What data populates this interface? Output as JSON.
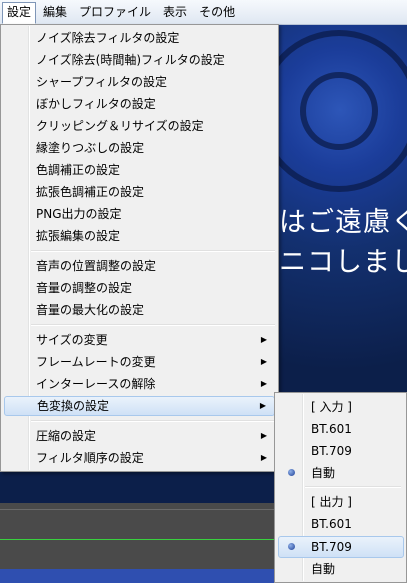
{
  "menubar": {
    "items": [
      "設定",
      "編集",
      "プロファイル",
      "表示",
      "その他"
    ]
  },
  "background": {
    "line1": "はご遠慮く",
    "line2": "ニコしまし"
  },
  "settings_menu": {
    "group1": [
      "ノイズ除去フィルタの設定",
      "ノイズ除去(時間軸)フィルタの設定",
      "シャープフィルタの設定",
      "ぼかしフィルタの設定",
      "クリッピング＆リサイズの設定",
      "縁塗りつぶしの設定",
      "色調補正の設定",
      "拡張色調補正の設定",
      "PNG出力の設定",
      "拡張編集の設定"
    ],
    "group2": [
      "音声の位置調整の設定",
      "音量の調整の設定",
      "音量の最大化の設定"
    ],
    "group3": [
      "サイズの変更",
      "フレームレートの変更",
      "インターレースの解除",
      "色変換の設定"
    ],
    "group4": [
      "圧縮の設定",
      "フィルタ順序の設定"
    ],
    "highlighted": "色変換の設定"
  },
  "color_submenu": {
    "input_header": "[ 入力 ]",
    "input_options": [
      "BT.601",
      "BT.709",
      "自動"
    ],
    "input_selected": "自動",
    "output_header": "[ 出力 ]",
    "output_options": [
      "BT.601",
      "BT.709",
      "自動"
    ],
    "output_selected": "BT.709"
  }
}
